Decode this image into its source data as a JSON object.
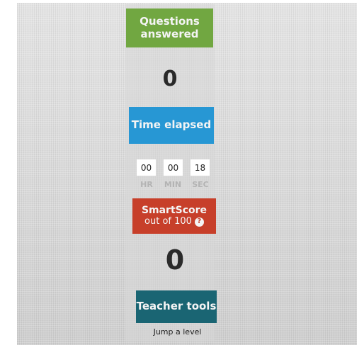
{
  "questions_answered": {
    "label": "Questions answered",
    "value": "0"
  },
  "time_elapsed": {
    "label": "Time elapsed",
    "hours": "00",
    "minutes": "00",
    "seconds": "18",
    "hr_label": "HR",
    "min_label": "MIN",
    "sec_label": "SEC"
  },
  "smartscore": {
    "label": "SmartScore",
    "sub_label": "out of 100",
    "help_icon": "?",
    "value": "0"
  },
  "teacher_tools": {
    "label": "Teacher tools",
    "jump_link": "Jump a level"
  },
  "colors": {
    "questions_green": "#71a741",
    "time_blue": "#2797d4",
    "smartscore_red": "#c73f2a",
    "teacher_teal": "#1a6573"
  }
}
